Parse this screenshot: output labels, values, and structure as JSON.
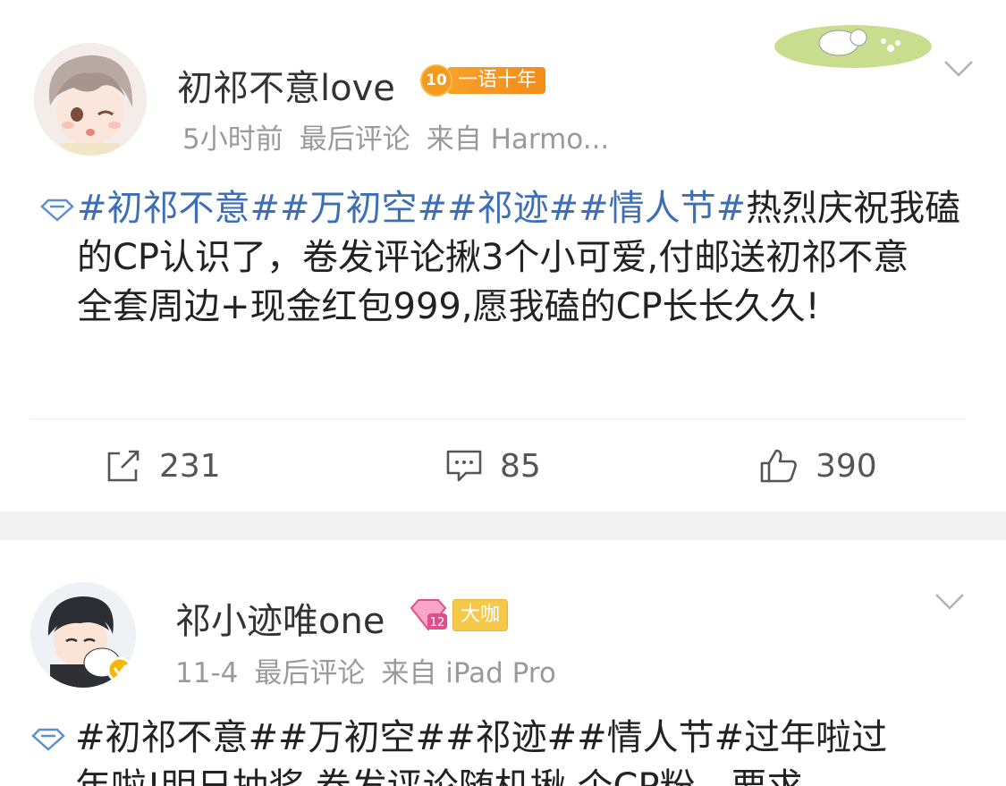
{
  "posts": [
    {
      "username": "初祁不意love",
      "badge": {
        "level": "10",
        "tag": "一语十年"
      },
      "meta": {
        "time": "5小时前",
        "last_comment": "最后评论",
        "source": "来自 Harmo..."
      },
      "content": {
        "line1_topics": [
          "#初祁不意#",
          "#万初空#",
          "#祁迹#",
          "#情人节#"
        ],
        "line1_text": "热烈庆祝我磕",
        "line2": "的CP认识了，卷发评论揪3个小可爱,付邮送初祁不意",
        "line3": "全套周边+现金红包999,愿我磕的CP长长久久!"
      },
      "actions": {
        "share": "231",
        "comment": "85",
        "like": "390"
      }
    },
    {
      "username": "祁小迹唯one",
      "badge": {
        "level": "12",
        "tag": "大咖"
      },
      "meta": {
        "time": "11-4",
        "last_comment": "最后评论",
        "source": "来自 iPad Pro"
      },
      "content": {
        "line1_topics": [
          "#初祁不意#",
          "#万初空#",
          "#祁迹#",
          "#情人节#"
        ],
        "line1_text": "过年啦过",
        "line2": "年啦!明日抽奖 卷发评论随机揪 个CP粉，要求"
      }
    }
  ],
  "colors": {
    "topic": "#3c6fb6",
    "meta": "#9a9a9a",
    "badge_orange": "#f39b1f",
    "badge_gold": "#f6c84a"
  },
  "icons": [
    "diamond-icon",
    "chevron-down-icon",
    "share-icon",
    "comment-icon",
    "like-icon"
  ]
}
